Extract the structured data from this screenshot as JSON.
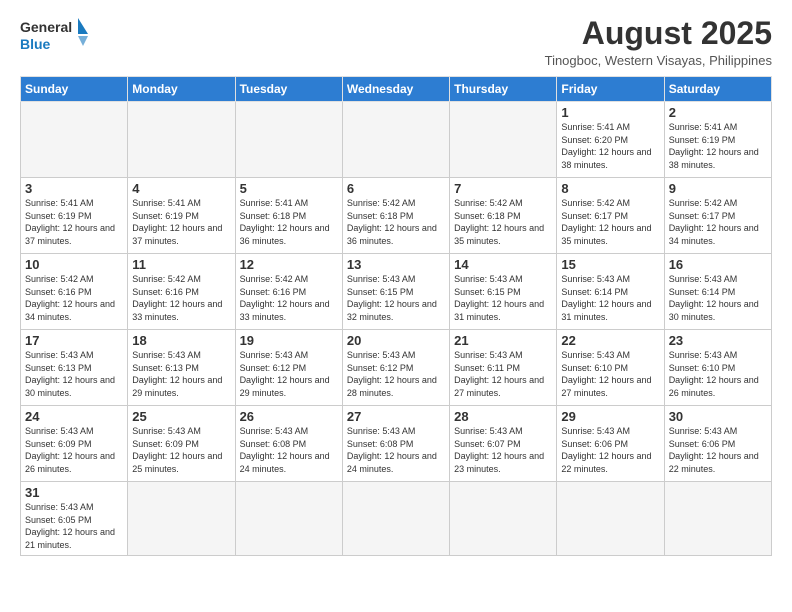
{
  "header": {
    "logo_general": "General",
    "logo_blue": "Blue",
    "title": "August 2025",
    "subtitle": "Tinogboc, Western Visayas, Philippines"
  },
  "days_of_week": [
    "Sunday",
    "Monday",
    "Tuesday",
    "Wednesday",
    "Thursday",
    "Friday",
    "Saturday"
  ],
  "weeks": [
    {
      "days": [
        {
          "num": "",
          "info": ""
        },
        {
          "num": "",
          "info": ""
        },
        {
          "num": "",
          "info": ""
        },
        {
          "num": "",
          "info": ""
        },
        {
          "num": "",
          "info": ""
        },
        {
          "num": "1",
          "info": "Sunrise: 5:41 AM\nSunset: 6:20 PM\nDaylight: 12 hours\nand 38 minutes."
        },
        {
          "num": "2",
          "info": "Sunrise: 5:41 AM\nSunset: 6:19 PM\nDaylight: 12 hours\nand 38 minutes."
        }
      ]
    },
    {
      "days": [
        {
          "num": "3",
          "info": "Sunrise: 5:41 AM\nSunset: 6:19 PM\nDaylight: 12 hours\nand 37 minutes."
        },
        {
          "num": "4",
          "info": "Sunrise: 5:41 AM\nSunset: 6:19 PM\nDaylight: 12 hours\nand 37 minutes."
        },
        {
          "num": "5",
          "info": "Sunrise: 5:41 AM\nSunset: 6:18 PM\nDaylight: 12 hours\nand 36 minutes."
        },
        {
          "num": "6",
          "info": "Sunrise: 5:42 AM\nSunset: 6:18 PM\nDaylight: 12 hours\nand 36 minutes."
        },
        {
          "num": "7",
          "info": "Sunrise: 5:42 AM\nSunset: 6:18 PM\nDaylight: 12 hours\nand 35 minutes."
        },
        {
          "num": "8",
          "info": "Sunrise: 5:42 AM\nSunset: 6:17 PM\nDaylight: 12 hours\nand 35 minutes."
        },
        {
          "num": "9",
          "info": "Sunrise: 5:42 AM\nSunset: 6:17 PM\nDaylight: 12 hours\nand 34 minutes."
        }
      ]
    },
    {
      "days": [
        {
          "num": "10",
          "info": "Sunrise: 5:42 AM\nSunset: 6:16 PM\nDaylight: 12 hours\nand 34 minutes."
        },
        {
          "num": "11",
          "info": "Sunrise: 5:42 AM\nSunset: 6:16 PM\nDaylight: 12 hours\nand 33 minutes."
        },
        {
          "num": "12",
          "info": "Sunrise: 5:42 AM\nSunset: 6:16 PM\nDaylight: 12 hours\nand 33 minutes."
        },
        {
          "num": "13",
          "info": "Sunrise: 5:43 AM\nSunset: 6:15 PM\nDaylight: 12 hours\nand 32 minutes."
        },
        {
          "num": "14",
          "info": "Sunrise: 5:43 AM\nSunset: 6:15 PM\nDaylight: 12 hours\nand 31 minutes."
        },
        {
          "num": "15",
          "info": "Sunrise: 5:43 AM\nSunset: 6:14 PM\nDaylight: 12 hours\nand 31 minutes."
        },
        {
          "num": "16",
          "info": "Sunrise: 5:43 AM\nSunset: 6:14 PM\nDaylight: 12 hours\nand 30 minutes."
        }
      ]
    },
    {
      "days": [
        {
          "num": "17",
          "info": "Sunrise: 5:43 AM\nSunset: 6:13 PM\nDaylight: 12 hours\nand 30 minutes."
        },
        {
          "num": "18",
          "info": "Sunrise: 5:43 AM\nSunset: 6:13 PM\nDaylight: 12 hours\nand 29 minutes."
        },
        {
          "num": "19",
          "info": "Sunrise: 5:43 AM\nSunset: 6:12 PM\nDaylight: 12 hours\nand 29 minutes."
        },
        {
          "num": "20",
          "info": "Sunrise: 5:43 AM\nSunset: 6:12 PM\nDaylight: 12 hours\nand 28 minutes."
        },
        {
          "num": "21",
          "info": "Sunrise: 5:43 AM\nSunset: 6:11 PM\nDaylight: 12 hours\nand 27 minutes."
        },
        {
          "num": "22",
          "info": "Sunrise: 5:43 AM\nSunset: 6:10 PM\nDaylight: 12 hours\nand 27 minutes."
        },
        {
          "num": "23",
          "info": "Sunrise: 5:43 AM\nSunset: 6:10 PM\nDaylight: 12 hours\nand 26 minutes."
        }
      ]
    },
    {
      "days": [
        {
          "num": "24",
          "info": "Sunrise: 5:43 AM\nSunset: 6:09 PM\nDaylight: 12 hours\nand 26 minutes."
        },
        {
          "num": "25",
          "info": "Sunrise: 5:43 AM\nSunset: 6:09 PM\nDaylight: 12 hours\nand 25 minutes."
        },
        {
          "num": "26",
          "info": "Sunrise: 5:43 AM\nSunset: 6:08 PM\nDaylight: 12 hours\nand 24 minutes."
        },
        {
          "num": "27",
          "info": "Sunrise: 5:43 AM\nSunset: 6:08 PM\nDaylight: 12 hours\nand 24 minutes."
        },
        {
          "num": "28",
          "info": "Sunrise: 5:43 AM\nSunset: 6:07 PM\nDaylight: 12 hours\nand 23 minutes."
        },
        {
          "num": "29",
          "info": "Sunrise: 5:43 AM\nSunset: 6:06 PM\nDaylight: 12 hours\nand 22 minutes."
        },
        {
          "num": "30",
          "info": "Sunrise: 5:43 AM\nSunset: 6:06 PM\nDaylight: 12 hours\nand 22 minutes."
        }
      ]
    },
    {
      "days": [
        {
          "num": "31",
          "info": "Sunrise: 5:43 AM\nSunset: 6:05 PM\nDaylight: 12 hours\nand 21 minutes."
        },
        {
          "num": "",
          "info": ""
        },
        {
          "num": "",
          "info": ""
        },
        {
          "num": "",
          "info": ""
        },
        {
          "num": "",
          "info": ""
        },
        {
          "num": "",
          "info": ""
        },
        {
          "num": "",
          "info": ""
        }
      ]
    }
  ]
}
